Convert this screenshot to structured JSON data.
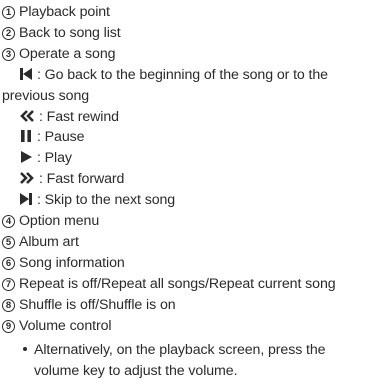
{
  "items": {
    "i1": {
      "num": "1",
      "text": "Playback point"
    },
    "i2": {
      "num": "2",
      "text": "Back to song list"
    },
    "i3": {
      "num": "3",
      "text": "Operate a song"
    },
    "i4": {
      "num": "4",
      "text": "Option menu"
    },
    "i5": {
      "num": "5",
      "text": "Album art"
    },
    "i6": {
      "num": "6",
      "text": "Song information"
    },
    "i7": {
      "num": "7",
      "text": "Repeat is off/Repeat all songs/Repeat current song"
    },
    "i8": {
      "num": "8",
      "text": "Shuffle is off/Shuffle is on"
    },
    "i9": {
      "num": "9",
      "text": "Volume control"
    }
  },
  "controls": {
    "skip_back_line1": ": Go back to the beginning of the song or to the",
    "skip_back_line2": "previous song",
    "fast_rewind": ": Fast rewind",
    "pause": ": Pause",
    "play": ": Play",
    "fast_forward": ": Fast forward",
    "skip_next": ": Skip to the next song"
  },
  "note": {
    "line1": "Alternatively, on the playback screen, press the",
    "line2": "volume key to adjust the volume."
  },
  "icons": {
    "skip_back": "skip-back-icon",
    "fast_rewind": "fast-rewind-icon",
    "pause": "pause-icon",
    "play": "play-icon",
    "fast_forward": "fast-forward-icon",
    "skip_next": "skip-next-icon"
  },
  "colors": {
    "text": "#2b2b2b",
    "icon": "#2b2b2b"
  }
}
